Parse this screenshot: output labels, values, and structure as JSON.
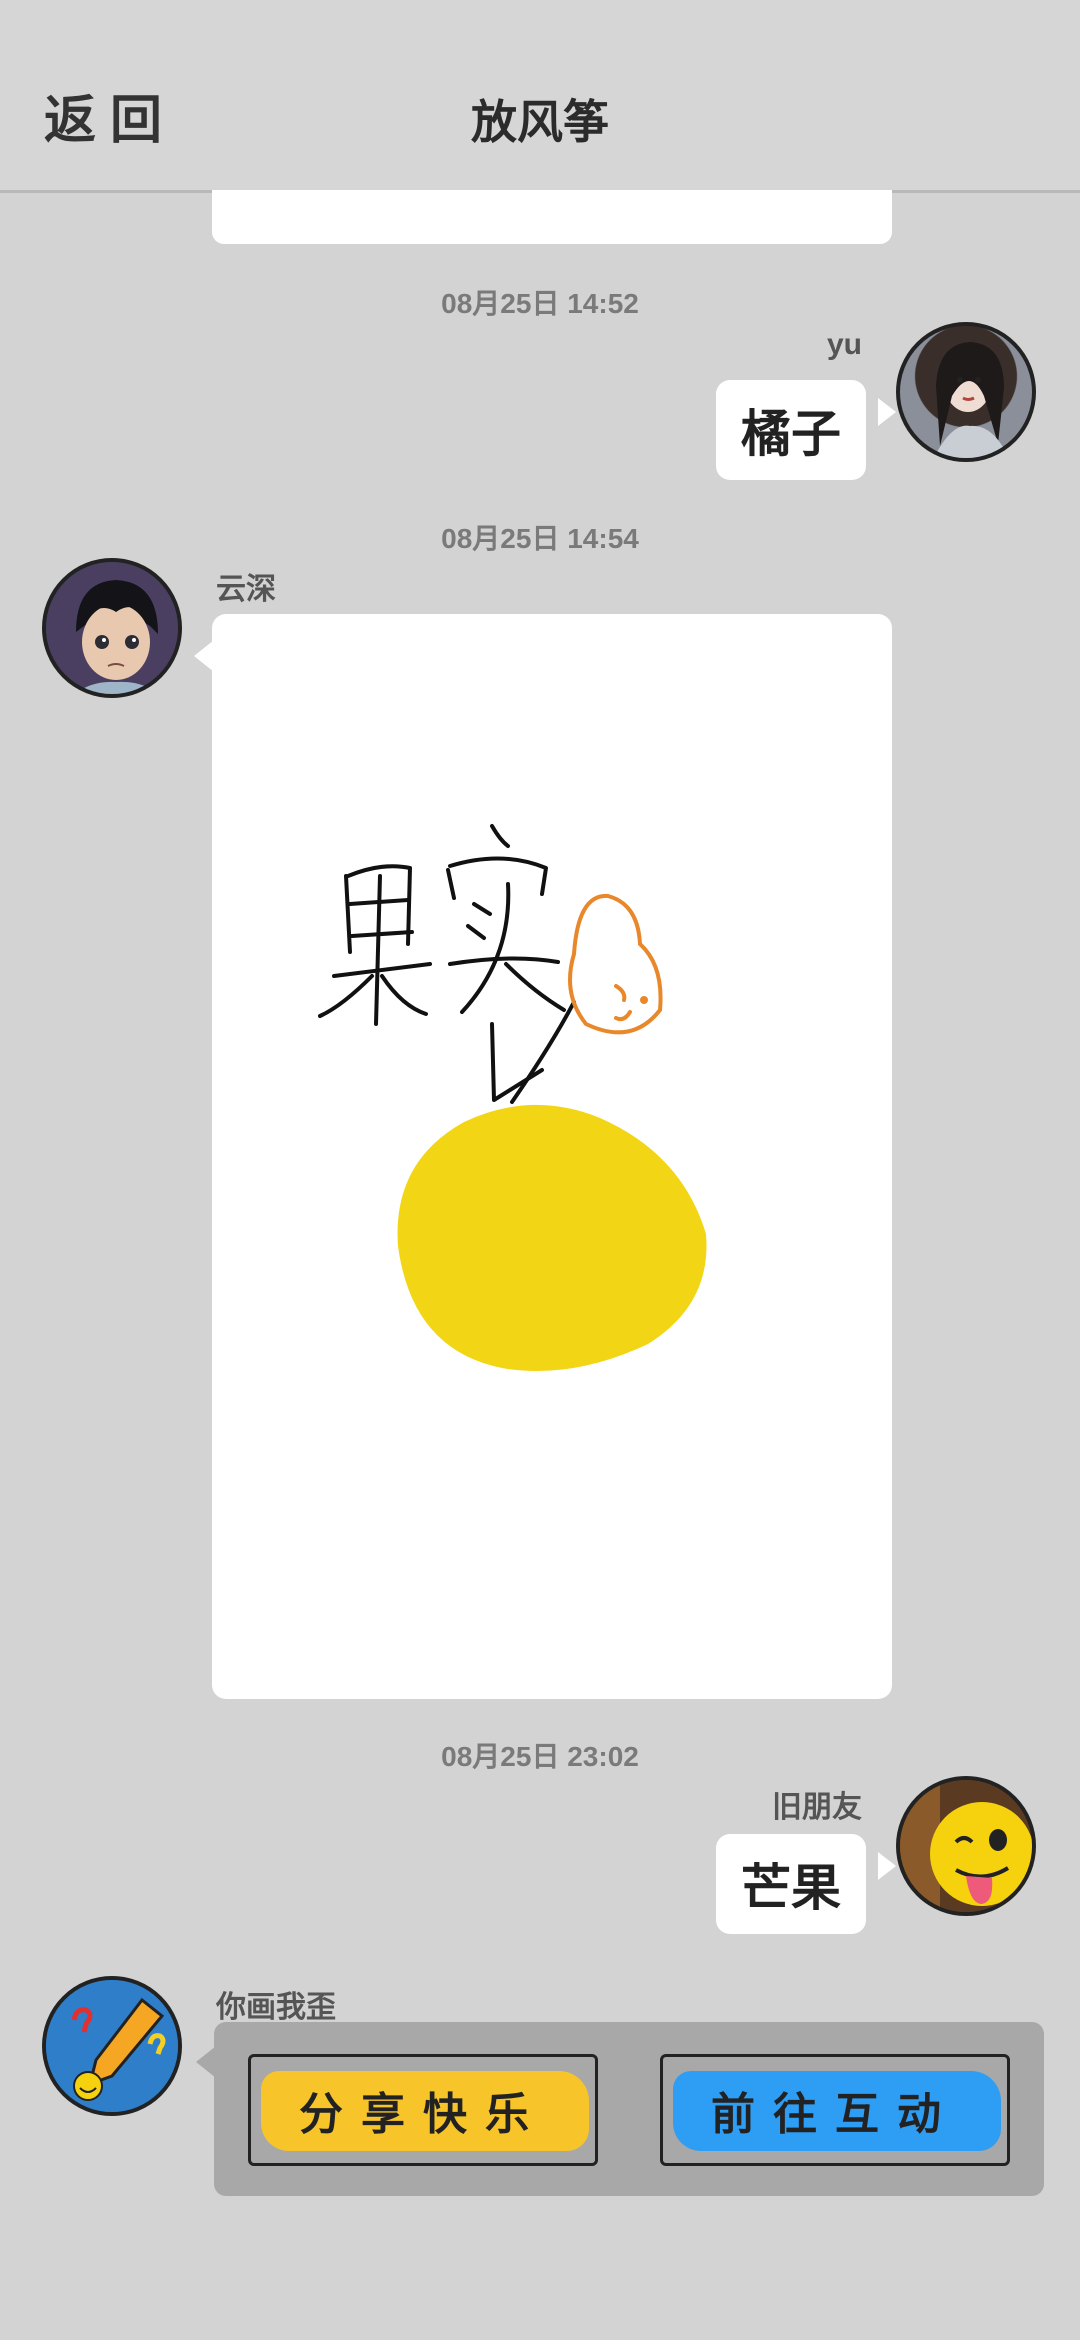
{
  "header": {
    "back_label": "返回",
    "title": "放风筝"
  },
  "messages": [
    {
      "timestamp": "08月25日  14:52",
      "sender": "yu",
      "text": "橘子",
      "side": "right"
    },
    {
      "timestamp": "08月25日  14:54",
      "sender": "云深",
      "type": "drawing",
      "drawing_text": "果实",
      "side": "left"
    },
    {
      "timestamp": "08月25日  23:02",
      "sender": "旧朋友",
      "text": "芒果",
      "side": "right"
    },
    {
      "sender": "你画我歪",
      "type": "game-card",
      "side": "left",
      "buttons": [
        {
          "label": "分享快乐",
          "color": "#f7c52a"
        },
        {
          "label": "前往互动",
          "color": "#2e9ef5"
        }
      ]
    }
  ],
  "colors": {
    "background": "#d3d3d3",
    "bubble": "#ffffff",
    "fruit": "#f2d616",
    "sketch_orange": "#e8882a"
  }
}
